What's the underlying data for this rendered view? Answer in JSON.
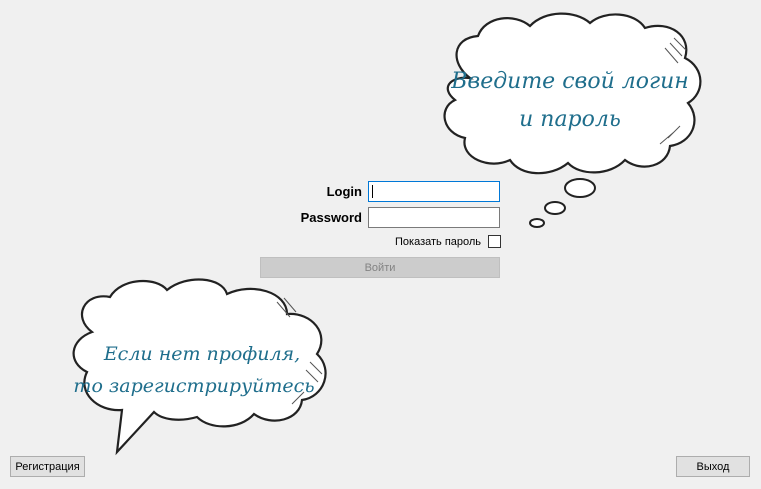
{
  "login_form": {
    "login_label": "Login",
    "login_value": "",
    "password_label": "Password",
    "password_value": "",
    "show_password_label": "Показать пароль",
    "show_password_checked": false,
    "submit_label": "Войти",
    "submit_enabled": false
  },
  "hint_top": {
    "line1": "Введите свой логин",
    "line2": "и пароль"
  },
  "hint_bottom": {
    "line1": "Если нет профиля,",
    "line2": "то зарегистрируйтесь"
  },
  "footer": {
    "register_label": "Регистрация",
    "exit_label": "Выход"
  },
  "colors": {
    "background": "#f0f0f0",
    "hint_text": "#1f6e8c",
    "focus_border": "#0078d7"
  }
}
